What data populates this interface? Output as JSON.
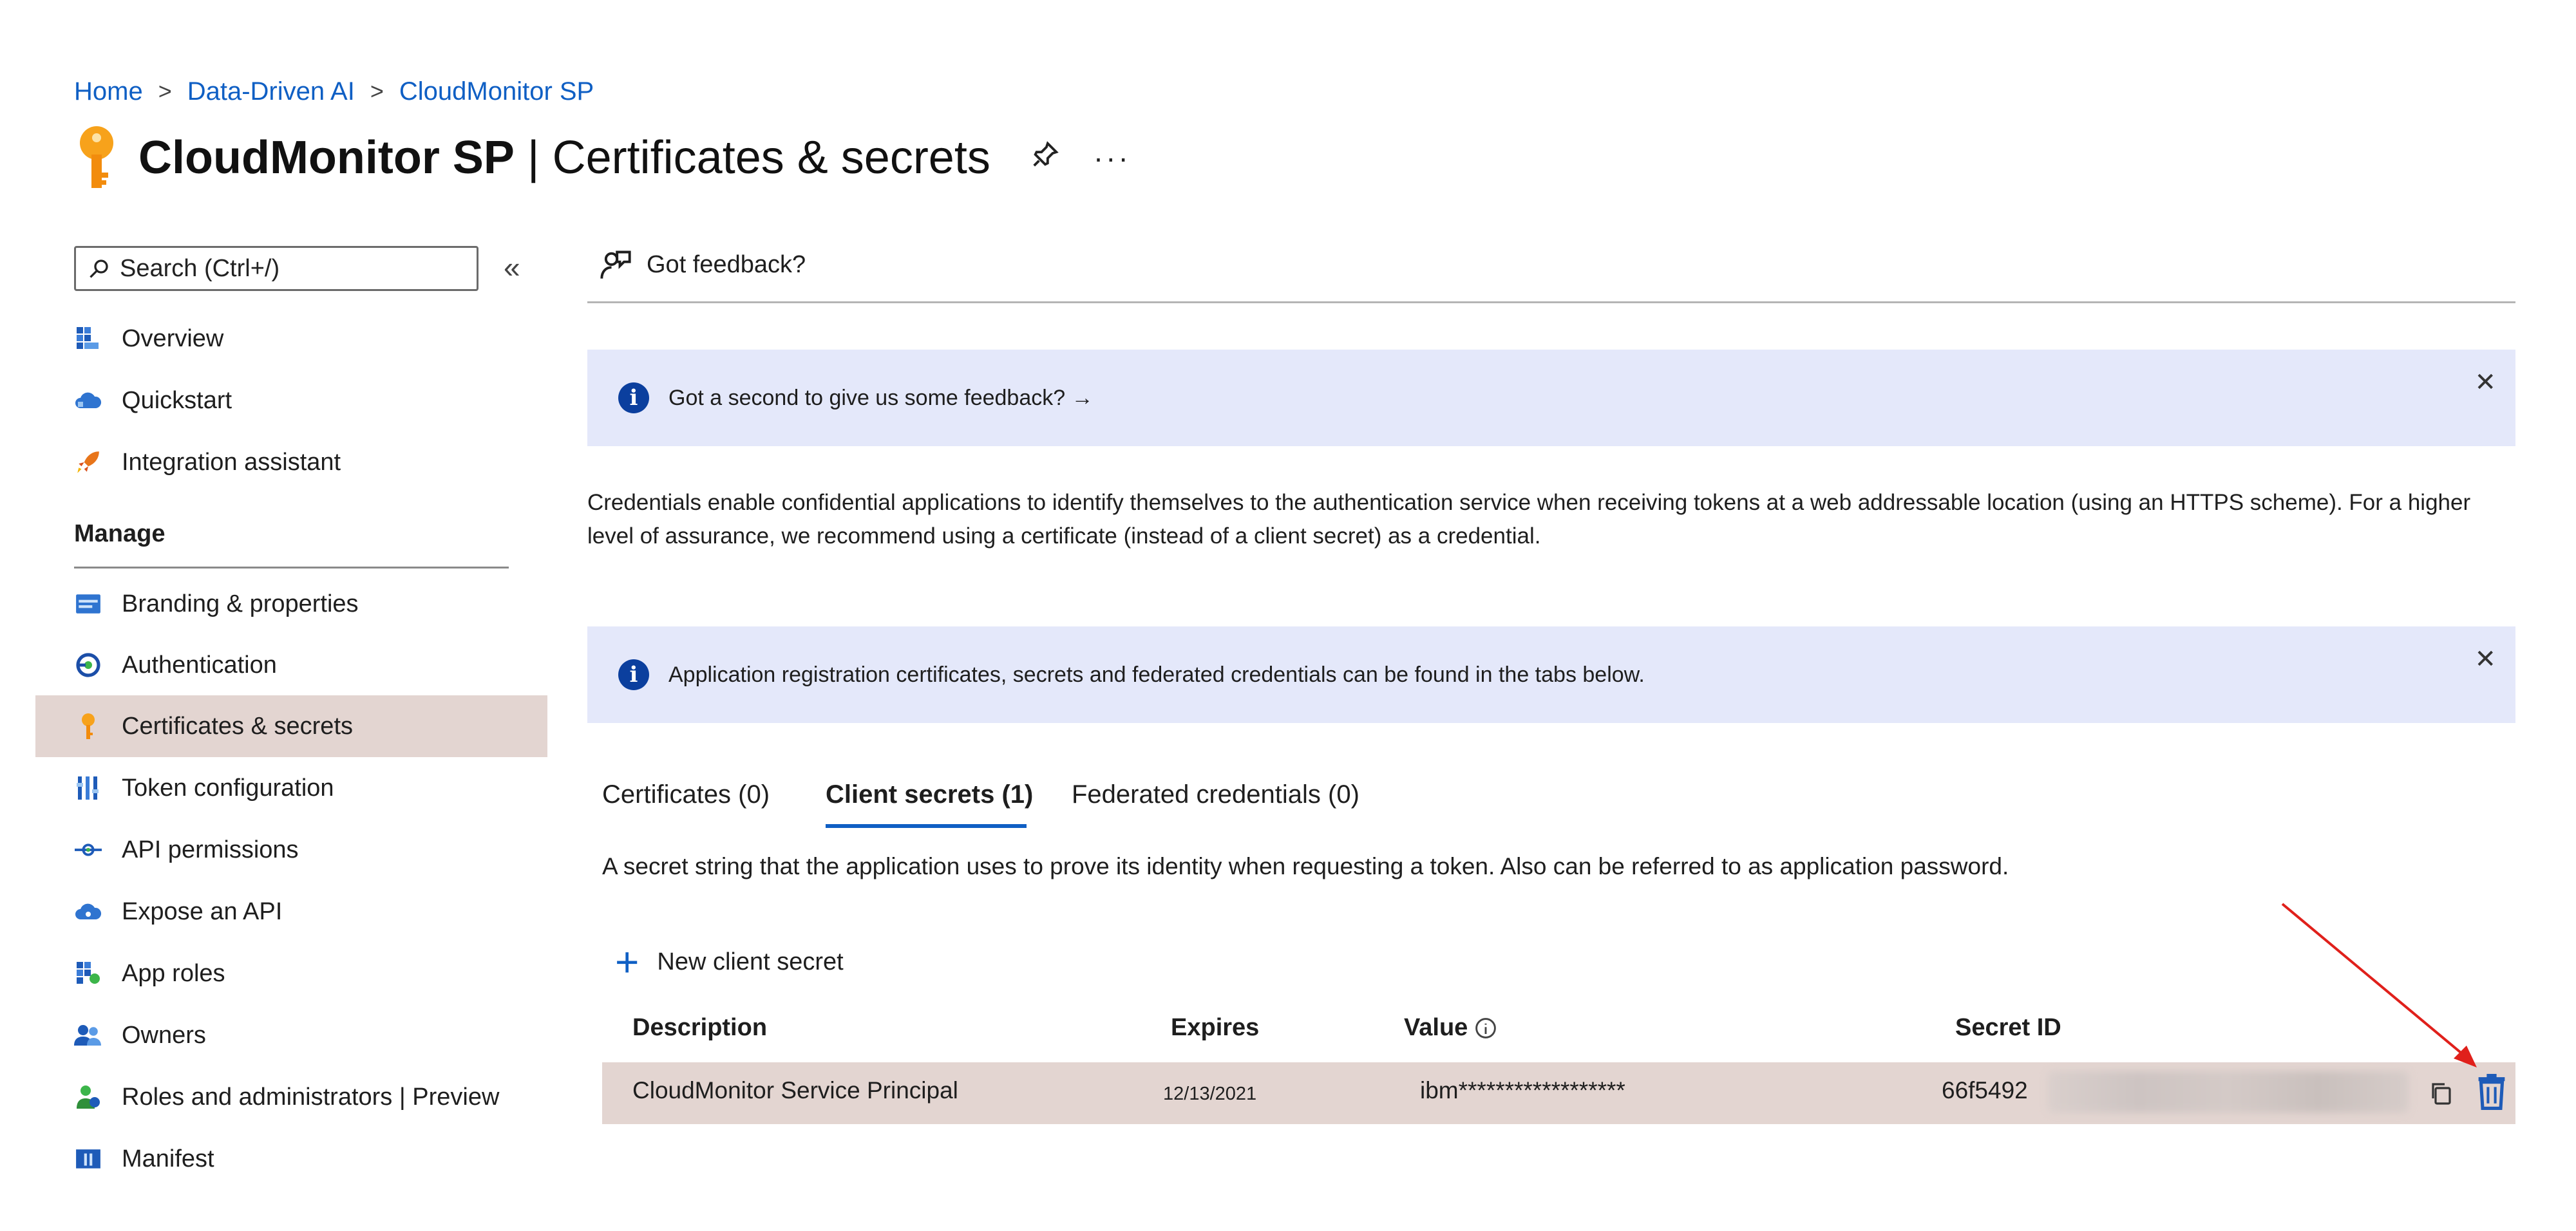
{
  "breadcrumb": [
    "Home",
    "Data-Driven AI",
    "CloudMonitor SP"
  ],
  "breadcrumb_separator": ">",
  "page": {
    "title_bold": "CloudMonitor SP",
    "title_rest": " | Certificates & secrets",
    "pin_icon": "pin-icon",
    "more_label": "···"
  },
  "sidebar": {
    "search_placeholder": "Search (Ctrl+/)",
    "collapse_label": "«",
    "top_items": [
      {
        "label": "Overview",
        "icon": "overview-icon"
      },
      {
        "label": "Quickstart",
        "icon": "cloud-quickstart-icon"
      },
      {
        "label": "Integration assistant",
        "icon": "rocket-icon"
      }
    ],
    "manage_heading": "Manage",
    "manage_items": [
      {
        "label": "Branding & properties",
        "icon": "branding-icon"
      },
      {
        "label": "Authentication",
        "icon": "authentication-icon"
      },
      {
        "label": "Certificates & secrets",
        "icon": "key-icon",
        "active": true
      },
      {
        "label": "Token configuration",
        "icon": "token-icon"
      },
      {
        "label": "API permissions",
        "icon": "api-permissions-icon"
      },
      {
        "label": "Expose an API",
        "icon": "cloud-api-icon"
      },
      {
        "label": "App roles",
        "icon": "app-roles-icon"
      },
      {
        "label": "Owners",
        "icon": "owners-icon"
      },
      {
        "label": "Roles and administrators | Preview",
        "icon": "roles-admin-icon"
      },
      {
        "label": "Manifest",
        "icon": "manifest-icon"
      }
    ]
  },
  "toolbar": {
    "feedback_label": "Got feedback?"
  },
  "banners": {
    "feedback": "Got a second to give us some feedback? →",
    "info": "Application registration certificates, secrets and federated credentials can be found in the tabs below.",
    "close_label": "✕"
  },
  "description": "Credentials enable confidential applications to identify themselves to the authentication service when receiving tokens at a web addressable location (using an HTTPS scheme). For a higher level of assurance, we recommend using a certificate (instead of a client secret) as a credential.",
  "tabs": [
    {
      "label": "Certificates (0)",
      "active": false
    },
    {
      "label": "Client secrets (1)",
      "active": true
    },
    {
      "label": "Federated credentials (0)",
      "active": false
    }
  ],
  "secrets_panel": {
    "description": "A secret string that the application uses to prove its identity when requesting a token. Also can be referred to as application password.",
    "new_button": "New client secret",
    "columns": [
      "Description",
      "Expires",
      "Value",
      "Secret ID"
    ],
    "rows": [
      {
        "description": "CloudMonitor Service Principal",
        "expires": "12/13/2021",
        "value": "ibm******************",
        "secret_id": "66f5492"
      }
    ]
  },
  "colors": {
    "link": "#0f5fc4",
    "active_row": "#e3d5d1",
    "banner_bg": "#e4e8fa",
    "annotation_arrow": "#e0201b"
  }
}
